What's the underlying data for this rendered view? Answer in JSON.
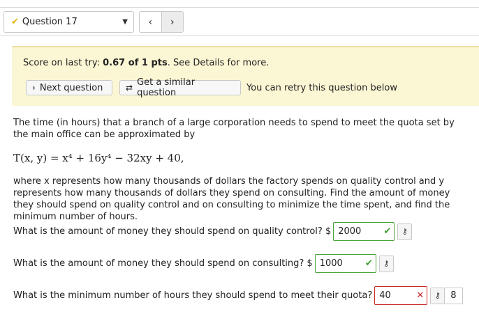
{
  "header": {
    "question_label": "Question 17",
    "check_icon": "check-icon",
    "prev_label": "‹",
    "next_label": "›"
  },
  "score": {
    "prefix": "Score on last try: ",
    "value": "0.67 of 1 pts",
    "suffix": ". See Details for more."
  },
  "actions": {
    "next_question": "Next question",
    "similar_question": "Get a similar question",
    "retry_note": "You can retry this question below"
  },
  "problem": {
    "intro": "The time (in hours) that a branch of a large corporation needs to spend to meet the quota set by the main office can be approximated by",
    "formula": "T(x, y) = x⁴ + 16y⁴ − 32xy + 40,",
    "where_text": "where x represents how many thousands of dollars the factory spends on quality control and y represents how many thousands of dollars they spend on consulting. Find the amount of money they should spend on quality control and on consulting to minimize the time spent, and find the minimum number of hours."
  },
  "questions": [
    {
      "text": "What is the amount of money they should spend on quality control? $",
      "value": "2000",
      "status": "correct"
    },
    {
      "text": "What is the amount of money they should spend on consulting? $",
      "value": "1000",
      "status": "correct"
    },
    {
      "text": "What is the minimum number of hours they should spend to meet their quota?",
      "value": "40",
      "status": "incorrect",
      "attempts": "8"
    }
  ],
  "colors": {
    "score_bg": "#fbf6d4",
    "correct": "#3a9a2a",
    "incorrect": "#c92a2a",
    "check_gold": "#e2b400"
  }
}
